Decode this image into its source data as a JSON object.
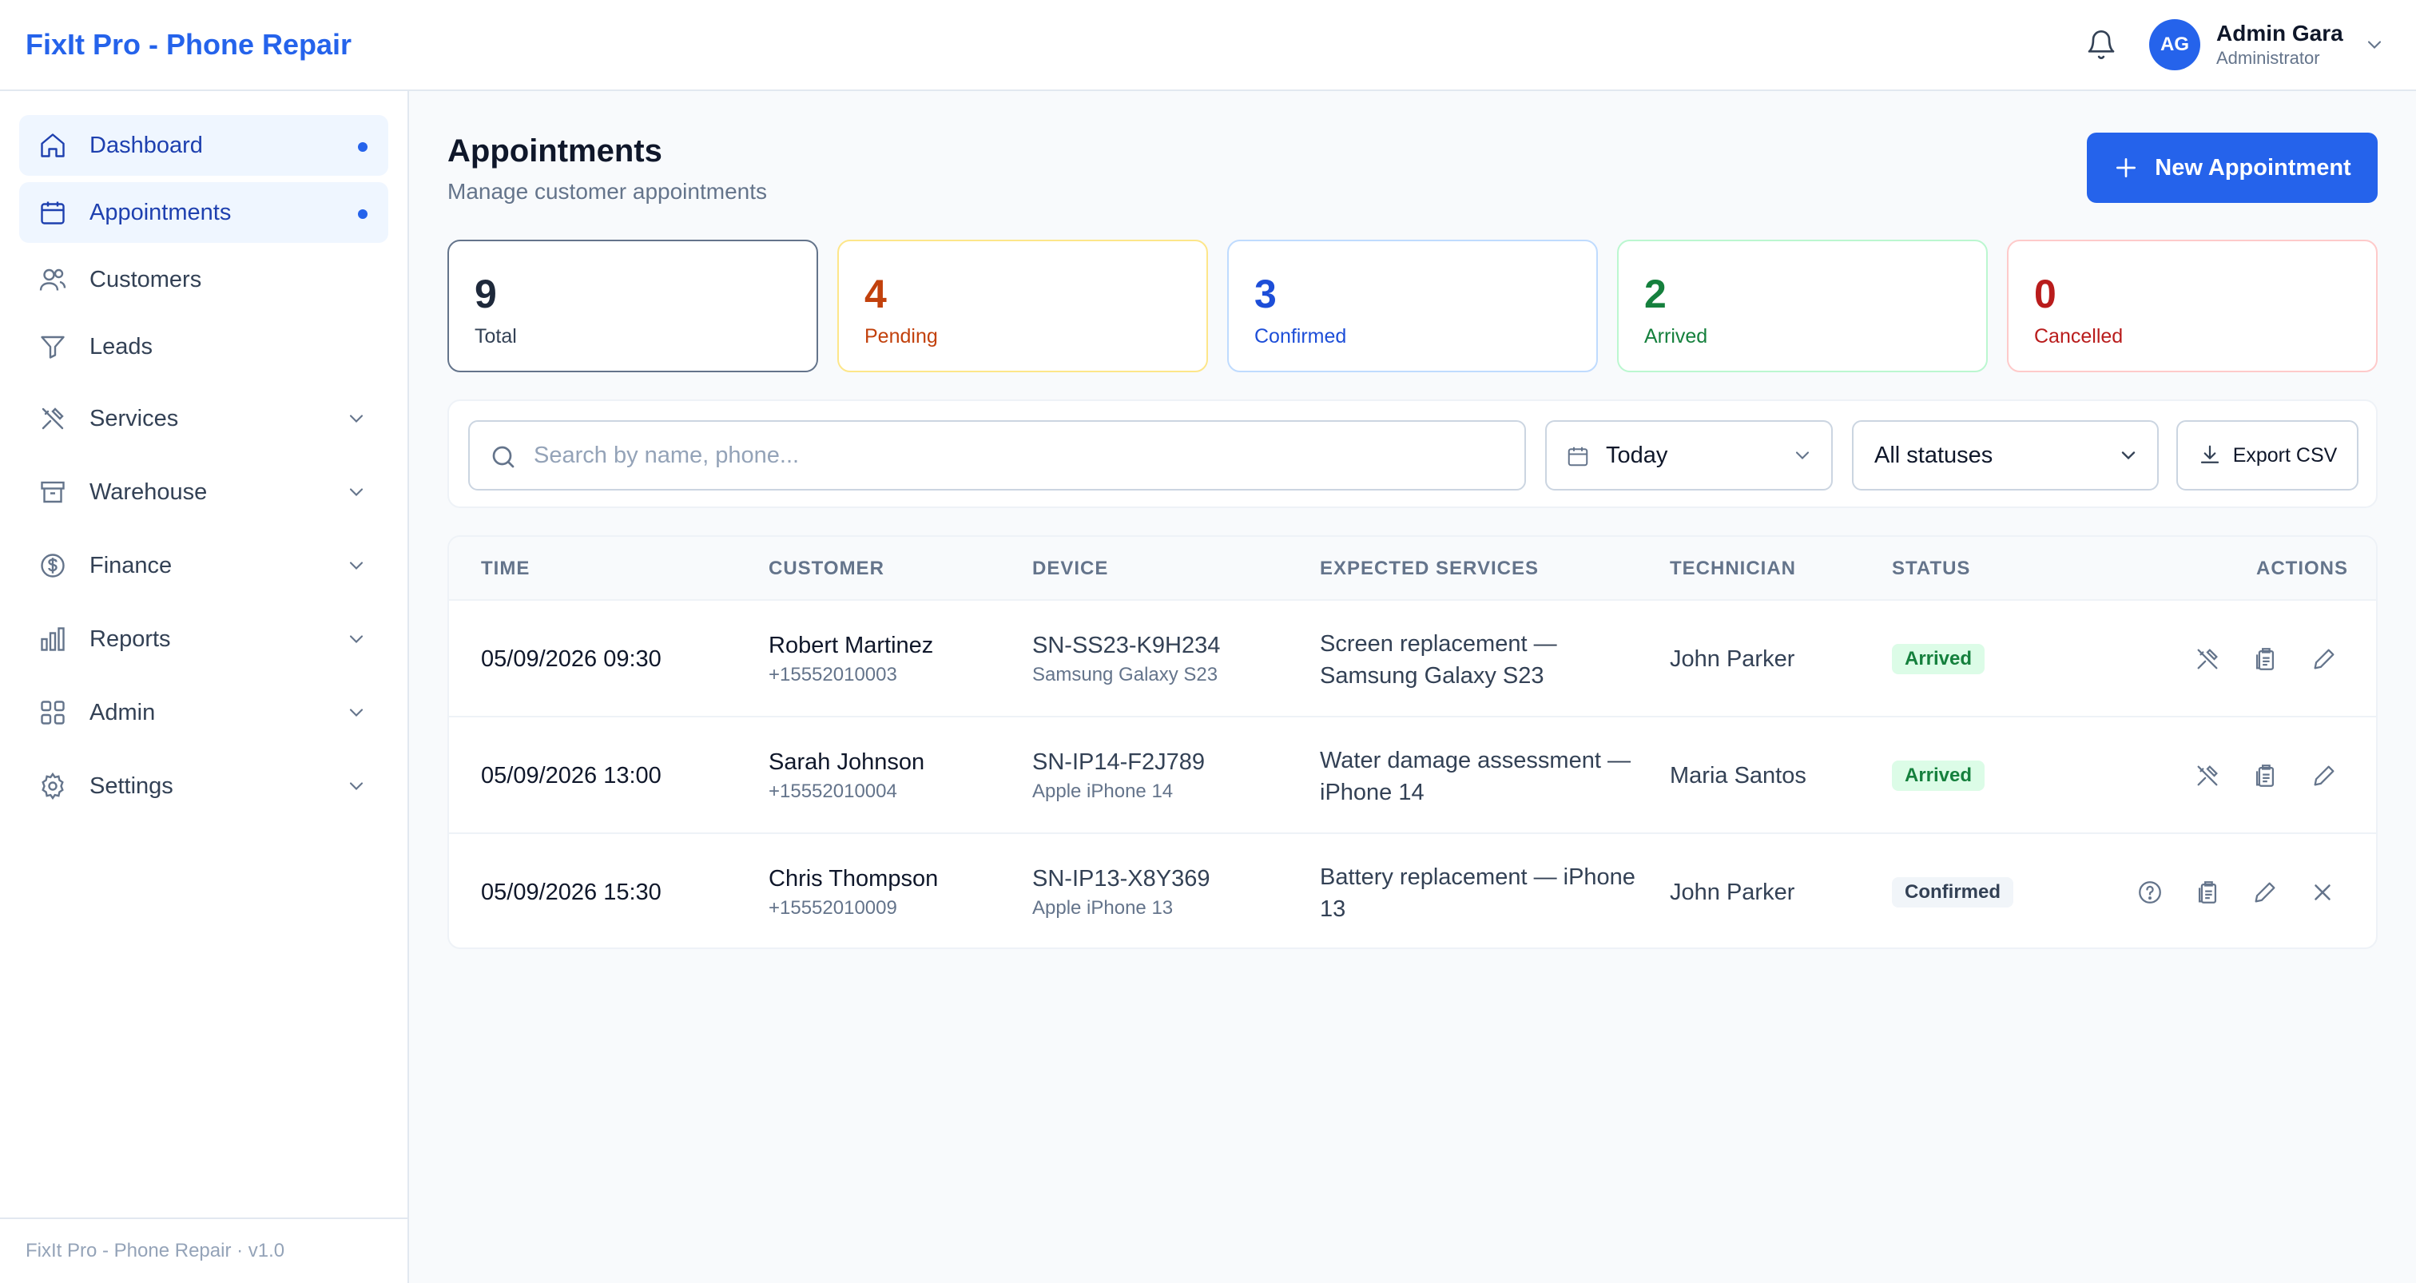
{
  "app": {
    "title": "FixIt Pro - Phone Repair",
    "footer": "FixIt Pro - Phone Repair · v1.0"
  },
  "user": {
    "initials": "AG",
    "name": "Admin Gara",
    "role": "Administrator"
  },
  "sidebar": {
    "items": [
      {
        "label": "Dashboard",
        "icon": "home-icon",
        "active": true,
        "dot": true
      },
      {
        "label": "Appointments",
        "icon": "calendar-icon",
        "active": true,
        "dot": true
      },
      {
        "label": "Customers",
        "icon": "users-icon"
      },
      {
        "label": "Leads",
        "icon": "funnel-icon"
      },
      {
        "label": "Services",
        "icon": "tools-icon",
        "expandable": true
      },
      {
        "label": "Warehouse",
        "icon": "archive-icon",
        "expandable": true
      },
      {
        "label": "Finance",
        "icon": "dollar-icon",
        "expandable": true
      },
      {
        "label": "Reports",
        "icon": "bar-chart-icon",
        "expandable": true
      },
      {
        "label": "Admin",
        "icon": "grid-icon",
        "expandable": true
      },
      {
        "label": "Settings",
        "icon": "gear-icon",
        "expandable": true
      }
    ]
  },
  "page": {
    "title": "Appointments",
    "subtitle": "Manage customer appointments",
    "new_button": "New Appointment"
  },
  "stats": [
    {
      "value": "9",
      "label": "Total",
      "color": "#1e293b",
      "border": "#64748b"
    },
    {
      "value": "4",
      "label": "Pending",
      "color": "#c2410c",
      "border": "#fde68a"
    },
    {
      "value": "3",
      "label": "Confirmed",
      "color": "#1d4ed8",
      "border": "#bfdbfe"
    },
    {
      "value": "2",
      "label": "Arrived",
      "color": "#15803d",
      "border": "#bbf7d0"
    },
    {
      "value": "0",
      "label": "Cancelled",
      "color": "#b91c1c",
      "border": "#fecaca"
    }
  ],
  "filters": {
    "search_placeholder": "Search by name, phone...",
    "date_value": "Today",
    "status_value": "All statuses",
    "export_label": "Export CSV"
  },
  "table": {
    "headers": [
      "TIME",
      "CUSTOMER",
      "DEVICE",
      "EXPECTED SERVICES",
      "TECHNICIAN",
      "STATUS",
      "ACTIONS"
    ],
    "rows": [
      {
        "time": "05/09/2026 09:30",
        "name": "Robert Martinez",
        "phone": "+15552010003",
        "serial": "SN-SS23-K9H234",
        "model": "Samsung Galaxy S23",
        "service": "Screen replacement — Samsung Galaxy S23",
        "tech": "John Parker",
        "status": "Arrived"
      },
      {
        "time": "05/09/2026 13:00",
        "name": "Sarah Johnson",
        "phone": "+15552010004",
        "serial": "SN-IP14-F2J789",
        "model": "Apple iPhone 14",
        "service": "Water damage assessment — iPhone 14",
        "tech": "Maria Santos",
        "status": "Arrived"
      },
      {
        "time": "05/09/2026 15:30",
        "name": "Chris Thompson",
        "phone": "+15552010009",
        "serial": "SN-IP13-X8Y369",
        "model": "Apple iPhone 13",
        "service": "Battery replacement — iPhone 13",
        "tech": "John Parker",
        "status": "Confirmed"
      }
    ]
  },
  "colors": {
    "accent": "#2563eb",
    "arrived_bg": "#dcfce7",
    "arrived_fg": "#15803d"
  }
}
